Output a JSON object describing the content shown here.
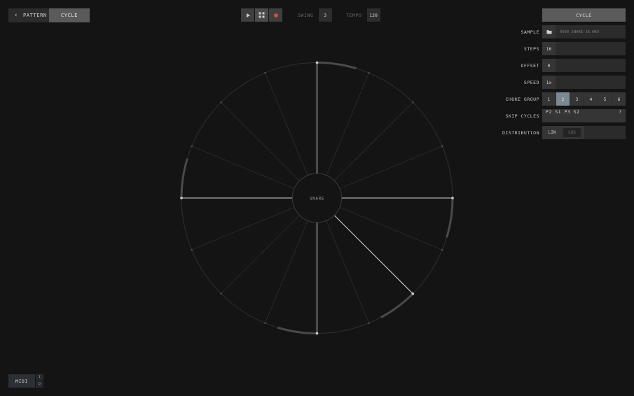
{
  "nav": {
    "back_label": "PATTERN",
    "active_label": "CYCLE"
  },
  "transport": {
    "swing_label": "SWING",
    "swing_value": "3",
    "tempo_label": "TEMPO",
    "tempo_value": "120",
    "record_color": "#e0503e",
    "icons": [
      "play-icon",
      "grid-icon",
      "record-icon"
    ]
  },
  "panel": {
    "mode_button": "CYCLE",
    "sample_label": "SAMPLE",
    "sample_file": "0000_SNARE-16.WAV",
    "steps_label": "STEPS",
    "steps_value": "16",
    "offset_label": "OFFSET",
    "offset_value": "0",
    "speed_label": "SPEED",
    "speed_value": "1x",
    "choke_label": "CHOKE GROUP",
    "choke_options": [
      "1",
      "2",
      "3",
      "4",
      "5",
      "6"
    ],
    "choke_selected": "2",
    "skip_label": "SKIP CYCLES",
    "skip_value": "P2 S1 P3 S2",
    "skip_help": "?",
    "distribution_label": "DISTRIBUTION",
    "distribution_options": [
      "LIN",
      "LOG"
    ],
    "distribution_selected": "LIN",
    "accent_color": "#7c8894"
  },
  "wheel": {
    "center_label": "SNARE",
    "steps": 16,
    "active_steps": [
      0,
      4,
      6,
      8,
      12
    ]
  },
  "midi": {
    "label": "MIDI",
    "in_label": "I",
    "out_label": "O"
  }
}
